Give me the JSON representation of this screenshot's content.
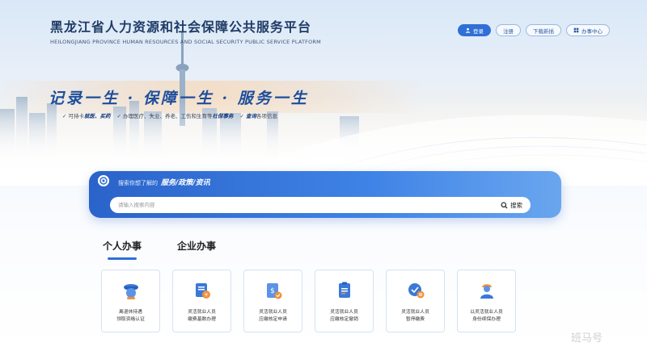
{
  "header": {
    "title_cn": "黑龙江省人力资源和社会保障公共服务平台",
    "title_en": "HEILONGJIANG PROVINCE HUMAN RESOURCES AND SOCIAL SECURITY PUBLIC SERVICE PLATFORM",
    "nav": [
      {
        "label": "登录",
        "icon": "user-icon",
        "primary": true
      },
      {
        "label": "注册",
        "primary": false
      },
      {
        "label": "下载新插",
        "primary": false
      },
      {
        "label": "办事中心",
        "icon": "grid-icon",
        "primary": false
      }
    ]
  },
  "hero": {
    "slogan": "记录一生 · 保障一生 · 服务一生",
    "sub_items": [
      {
        "prefix": "可持卡",
        "bold": "就医、买药",
        "suffix": ""
      },
      {
        "prefix": "办理医疗、失业、养老、工伤和生育等",
        "bold": "社保事务",
        "suffix": ""
      },
      {
        "prefix": "",
        "bold": "查询",
        "suffix": "各项信息"
      }
    ]
  },
  "search": {
    "prompt": "搜索你想了解的",
    "prompt_bold": "服务/政策/资讯",
    "placeholder": "请输入搜索内容",
    "button": "搜索"
  },
  "tabs": [
    {
      "label": "个人办事",
      "active": true
    },
    {
      "label": "企业办事",
      "active": false
    }
  ],
  "cards": [
    {
      "label": "离退休待遇\n领取资格认证",
      "icon": "retiree-icon"
    },
    {
      "label": "灵活就业人员\n缴费基数办理",
      "icon": "document-coin-icon"
    },
    {
      "label": "灵活就业人员\n应缴核定申请",
      "icon": "money-document-icon"
    },
    {
      "label": "灵活就业人员\n应缴核定撤销",
      "icon": "clipboard-icon"
    },
    {
      "label": "灵活就业人员\n暂停缴费",
      "icon": "pause-shield-icon"
    },
    {
      "label": "以灵活就业人员\n身份续保办理",
      "icon": "worker-icon"
    }
  ],
  "watermark": "班马号",
  "colors": {
    "primary": "#2f6fd6",
    "title": "#1f3b66",
    "slogan": "#1d4e9c"
  }
}
